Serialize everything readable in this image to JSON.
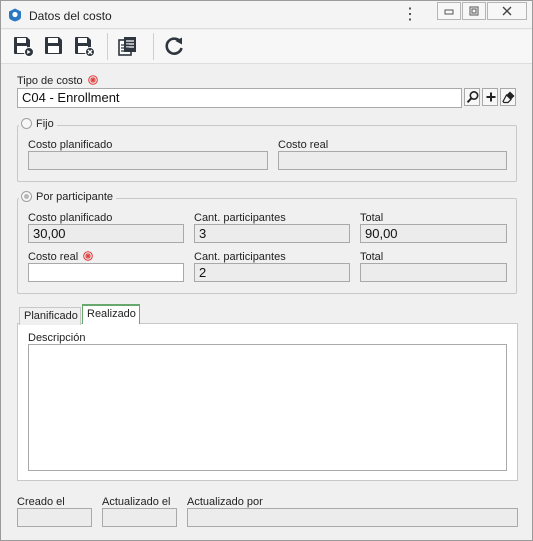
{
  "window": {
    "title": "Datos del costo"
  },
  "toolbar": {
    "buttons": [
      {
        "name": "save-and-new-icon"
      },
      {
        "name": "save-icon"
      },
      {
        "name": "save-and-close-icon"
      },
      {
        "name": "copy-icon"
      },
      {
        "name": "refresh-icon"
      }
    ]
  },
  "tipo_costo": {
    "label": "Tipo de costo",
    "value": "C04 - Enrollment"
  },
  "fijo": {
    "legend": "Fijo",
    "costo_planificado_label": "Costo planificado",
    "costo_planificado": "",
    "costo_real_label": "Costo real",
    "costo_real": ""
  },
  "por_participante": {
    "legend": "Por participante",
    "costo_planificado_label": "Costo planificado",
    "costo_planificado": "30,00",
    "cant_participantes_label": "Cant. participantes",
    "cant_participantes": "3",
    "total_label": "Total",
    "total": "90,00",
    "costo_real_label": "Costo real",
    "costo_real": "",
    "cant_participantes_real_label": "Cant. participantes",
    "cant_participantes_real": "2",
    "total_real_label": "Total",
    "total_real": ""
  },
  "tabs": [
    {
      "label": "Planificado",
      "active": false
    },
    {
      "label": "Realizado",
      "active": true
    }
  ],
  "descripcion": {
    "label": "Descripción",
    "value": ""
  },
  "audit": {
    "creado_label": "Creado el",
    "creado": "",
    "actualizado_label": "Actualizado el",
    "actualizado": "",
    "actualizado_por_label": "Actualizado por",
    "actualizado_por": ""
  },
  "colors": {
    "accent": "#69a86c",
    "required": "#e03a3a",
    "icon_dark": "#2f3640"
  }
}
